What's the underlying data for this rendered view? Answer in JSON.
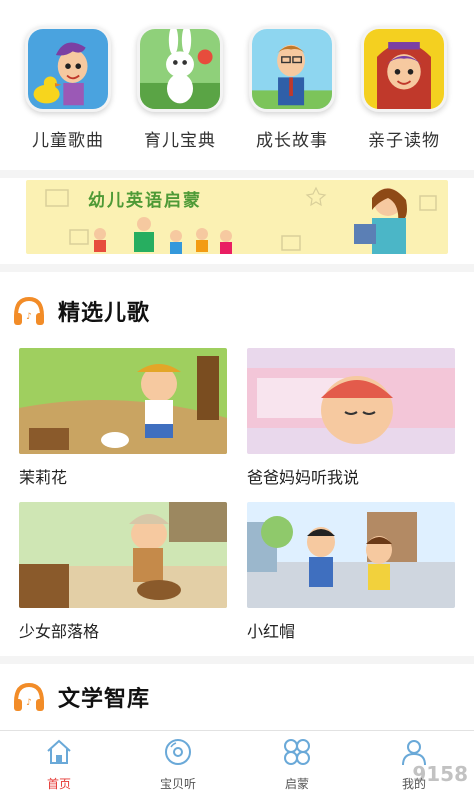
{
  "categories": [
    {
      "label": "儿童歌曲"
    },
    {
      "label": "育儿宝典"
    },
    {
      "label": "成长故事"
    },
    {
      "label": "亲子读物"
    }
  ],
  "banner": {
    "title": "幼儿英语启蒙"
  },
  "sections": {
    "songs": {
      "title": "精选儿歌"
    },
    "library": {
      "title": "文学智库"
    }
  },
  "songs": [
    {
      "name": "茉莉花"
    },
    {
      "name": "爸爸妈妈听我说"
    },
    {
      "name": "少女部落格"
    },
    {
      "name": "小红帽"
    }
  ],
  "tabs": [
    {
      "label": "首页",
      "icon": "home-icon",
      "active": true
    },
    {
      "label": "宝贝听",
      "icon": "disc-icon"
    },
    {
      "label": "启蒙",
      "icon": "petals-icon"
    },
    {
      "label": "我的",
      "icon": "user-icon"
    }
  ],
  "watermark": "9158",
  "colors": {
    "accent": "#e53935",
    "tab_icon": "#6aa9d8",
    "banner_bg": "#fbf1b3"
  }
}
